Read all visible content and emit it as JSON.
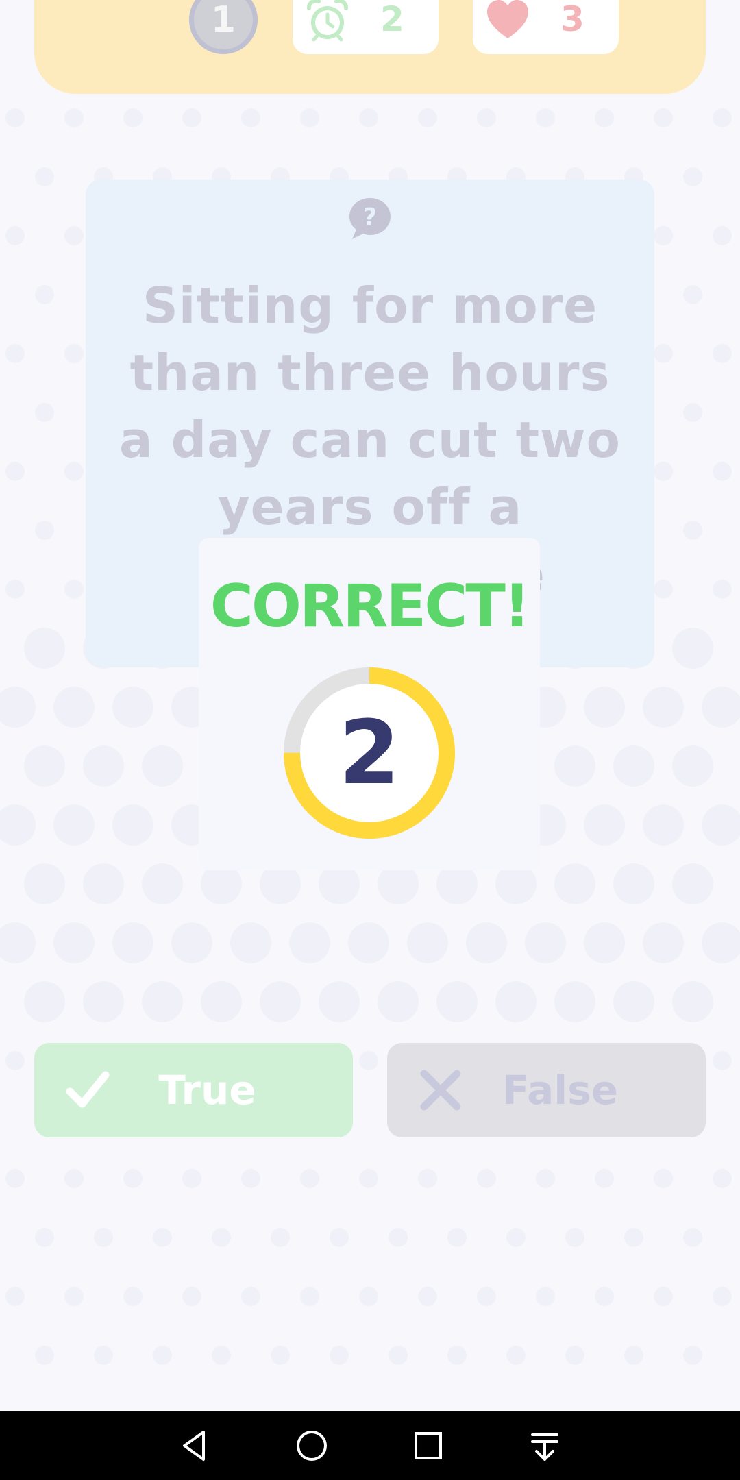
{
  "status_bar": {
    "level": "1",
    "timer_value": "2",
    "lives_value": "3",
    "timer_icon": "alarm-clock-icon",
    "lives_icon": "heart-icon"
  },
  "question": {
    "icon": "question-bubble-icon",
    "text": "Sitting for more than three hours a day can cut two years off a person's life expectancy."
  },
  "result": {
    "title": "CORRECT!",
    "countdown": "2",
    "countdown_progress": 0.75
  },
  "answers": {
    "true_label": "True",
    "false_label": "False"
  },
  "colors": {
    "correct_green": "#5cd66a",
    "ring_yellow": "#ffd93b",
    "top_bar_bg": "#feebbd"
  },
  "nav": {
    "back": "back-icon",
    "home": "home-icon",
    "recents": "recents-icon",
    "notifications": "notification-drawer-icon"
  }
}
